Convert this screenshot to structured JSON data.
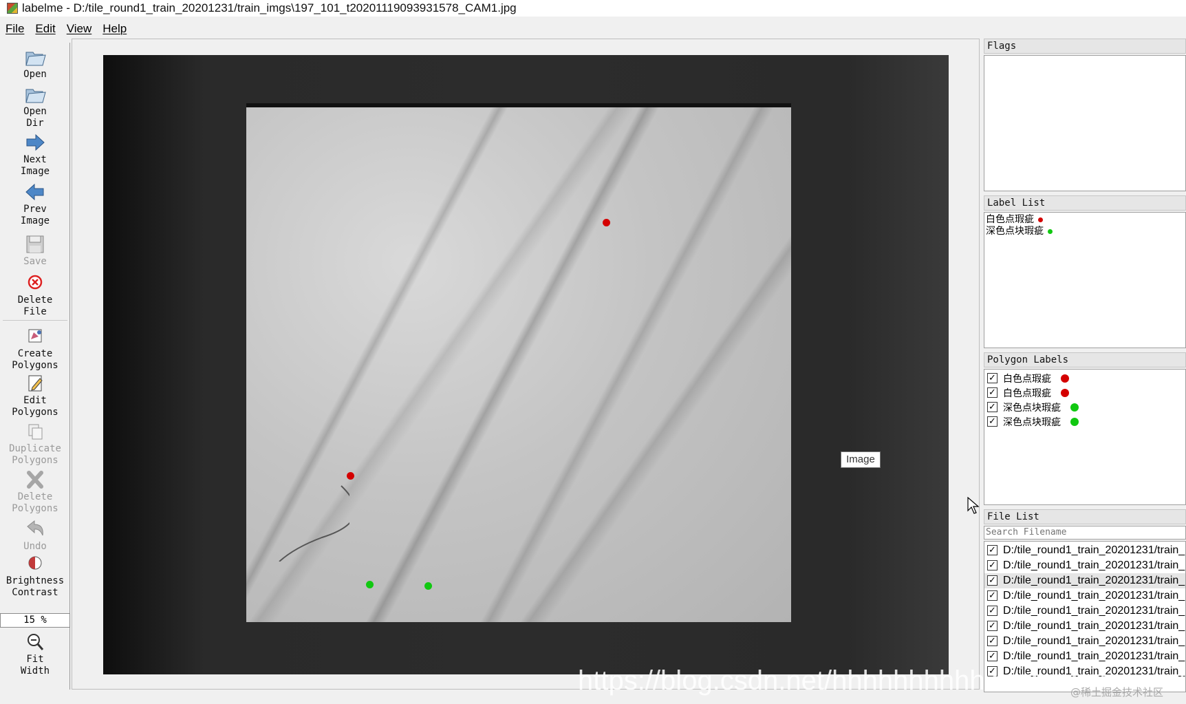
{
  "window": {
    "title": "labelme - D:/tile_round1_train_20201231/train_imgs\\197_101_t20201119093931578_CAM1.jpg"
  },
  "menu": [
    "File",
    "Edit",
    "View",
    "Help"
  ],
  "toolbar": {
    "open": "Open",
    "open_dir_1": "Open",
    "open_dir_2": "Dir",
    "next_1": "Next",
    "next_2": "Image",
    "prev_1": "Prev",
    "prev_2": "Image",
    "save": "Save",
    "delete_file_1": "Delete",
    "delete_file_2": "File",
    "create_1": "Create",
    "create_2": "Polygons",
    "edit_1": "Edit",
    "edit_2": "Polygons",
    "dup_1": "Duplicate",
    "dup_2": "Polygons",
    "delpoly_1": "Delete",
    "delpoly_2": "Polygons",
    "undo": "Undo",
    "bright_1": "Brightness",
    "bright_2": "Contrast",
    "zoom": "15 %",
    "fit_1": "Fit",
    "fit_2": "Width"
  },
  "canvas": {
    "tooltip": "Image"
  },
  "colors": {
    "red_label": "#d40000",
    "green_label": "#11c811"
  },
  "flags": {
    "title": "Flags"
  },
  "label_list": {
    "title": "Label List",
    "items": [
      {
        "label": "白色点瑕疵",
        "color": "#d40000"
      },
      {
        "label": "深色点块瑕疵",
        "color": "#11c811"
      }
    ]
  },
  "polygon_labels": {
    "title": "Polygon Labels",
    "items": [
      {
        "label": "白色点瑕疵",
        "checked": "✓",
        "color": "#d40000"
      },
      {
        "label": "白色点瑕疵",
        "checked": "✓",
        "color": "#d40000"
      },
      {
        "label": "深色点块瑕疵",
        "checked": "✓",
        "color": "#11c811"
      },
      {
        "label": "深色点块瑕疵",
        "checked": "✓",
        "color": "#11c811"
      }
    ]
  },
  "file_list": {
    "title": "File List",
    "search_placeholder": "Search Filename",
    "items": [
      "D:/tile_round1_train_20201231/train_",
      "D:/tile_round1_train_20201231/train_",
      "D:/tile_round1_train_20201231/train_",
      "D:/tile_round1_train_20201231/train_",
      "D:/tile_round1_train_20201231/train_",
      "D:/tile_round1_train_20201231/train_",
      "D:/tile_round1_train_20201231/train_",
      "D:/tile_round1_train_20201231/train_",
      "D:/tile_round1_train_20201231/train_"
    ],
    "checked": "✓"
  },
  "watermark": {
    "url": "https://blog.csdn.net/hhhhhhhhhhwwwwwwwwww",
    "credit": "@稀土掘金技术社区"
  }
}
